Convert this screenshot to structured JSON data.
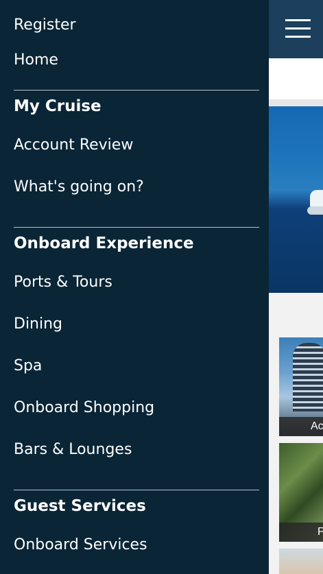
{
  "drawer": {
    "top_items": [
      {
        "label": "Register"
      },
      {
        "label": "Home"
      }
    ],
    "sections": [
      {
        "heading": "My Cruise",
        "items": [
          {
            "label": "Account Review"
          },
          {
            "label": "What's going on?"
          }
        ]
      },
      {
        "heading": "Onboard Experience",
        "items": [
          {
            "label": "Ports & Tours"
          },
          {
            "label": "Dining"
          },
          {
            "label": "Spa"
          },
          {
            "label": "Onboard Shopping"
          },
          {
            "label": "Bars & Lounges"
          }
        ]
      },
      {
        "heading": "Guest Services",
        "items": [
          {
            "label": "Onboard Services"
          }
        ]
      }
    ]
  },
  "background_app": {
    "menu_icon": "hamburger-menu-icon",
    "tiles": [
      {
        "caption": "Ac"
      },
      {
        "caption": "P"
      },
      {
        "caption": ""
      }
    ]
  },
  "colors": {
    "drawer_background": "#0a2536",
    "header_background": "#1b3f5c",
    "divider": "#b8c4cc",
    "text": "#ffffff"
  }
}
